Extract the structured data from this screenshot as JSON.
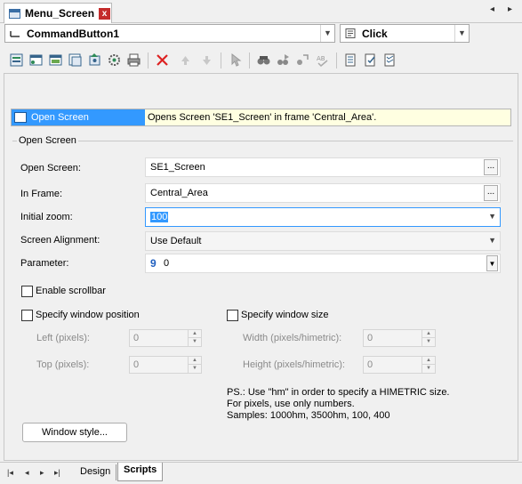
{
  "window": {
    "tab_title": "Menu_Screen",
    "close_glyph": "x",
    "nav_prev": "◂",
    "nav_next": "▸"
  },
  "object_selector": {
    "value": "CommandButton1"
  },
  "event_selector": {
    "value": "Click"
  },
  "toolbar": {
    "icons": [
      "insert-icon",
      "open-screen-icon",
      "close-screen-icon",
      "screen-icon",
      "execute-icon",
      "settings-icon",
      "print-icon",
      "delete-icon",
      "move-up-icon",
      "move-down-icon",
      "cursor-icon",
      "find-icon",
      "find-next-icon",
      "replace-icon",
      "spell-icon",
      "comment-icon",
      "uncomment-icon",
      "list-icon"
    ]
  },
  "command_list": {
    "selected_name": "Open Screen",
    "selected_description": "Opens Screen 'SE1_Screen' in frame 'Central_Area'."
  },
  "form": {
    "group_title": "Open Screen",
    "open_screen_label": "Open Screen:",
    "open_screen_value": "SE1_Screen",
    "in_frame_label": "In Frame:",
    "in_frame_value": "Central_Area",
    "initial_zoom_label": "Initial zoom:",
    "initial_zoom_value": "100",
    "alignment_label": "Screen Alignment:",
    "alignment_value": "Use Default",
    "parameter_label": "Parameter:",
    "parameter_value": "0",
    "parameter_icon": "9",
    "ellipsis": "...",
    "enable_scrollbar": "Enable scrollbar",
    "specify_position": "Specify window position",
    "specify_size": "Specify window size",
    "left_label": "Left (pixels):",
    "left_value": "0",
    "top_label": "Top (pixels):",
    "top_value": "0",
    "width_label": "Width (pixels/himetric):",
    "width_value": "0",
    "height_label": "Height (pixels/himetric):",
    "height_value": "0",
    "help_line1": "PS.: Use \"hm\" in order to specify a HIMETRIC size.",
    "help_line2": "For pixels, use only numbers.",
    "help_line3": "Samples: 1000hm, 3500hm, 100, 400",
    "window_style_button": "Window style..."
  },
  "bottom_tabs": {
    "design": "Design",
    "scripts": "Scripts"
  },
  "colors": {
    "selection": "#3399ff",
    "description_bg": "#ffffe1",
    "close_red": "#c42b2b"
  }
}
